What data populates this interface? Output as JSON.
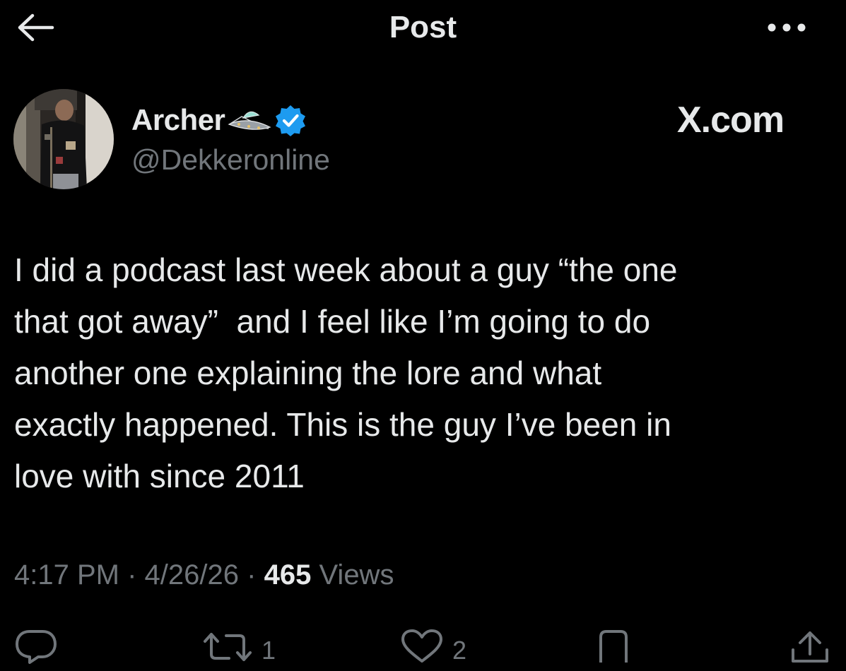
{
  "header": {
    "title": "Post"
  },
  "author": {
    "display_name": "Archer",
    "handle": "@Dekkeronline",
    "emoji": "flying-saucer",
    "verified": true
  },
  "brand_watermark": "X.com",
  "post": {
    "text": "I did a podcast last week about a guy “the one\nthat got away”  and I feel like I’m going to do\nanother one explaining the lore and what\nexactly happened. This is the guy I’ve been in\nlove with since 2011",
    "time": "4:17 PM",
    "separator": "·",
    "date": "4/26/26",
    "views_count": "465",
    "views_label": "Views"
  },
  "actions": {
    "replies": "",
    "reposts": "1",
    "likes": "2"
  },
  "colors": {
    "background": "#000000",
    "text_primary": "#e7e9ea",
    "text_secondary": "#71767b",
    "verified_blue": "#1d9bf0"
  }
}
